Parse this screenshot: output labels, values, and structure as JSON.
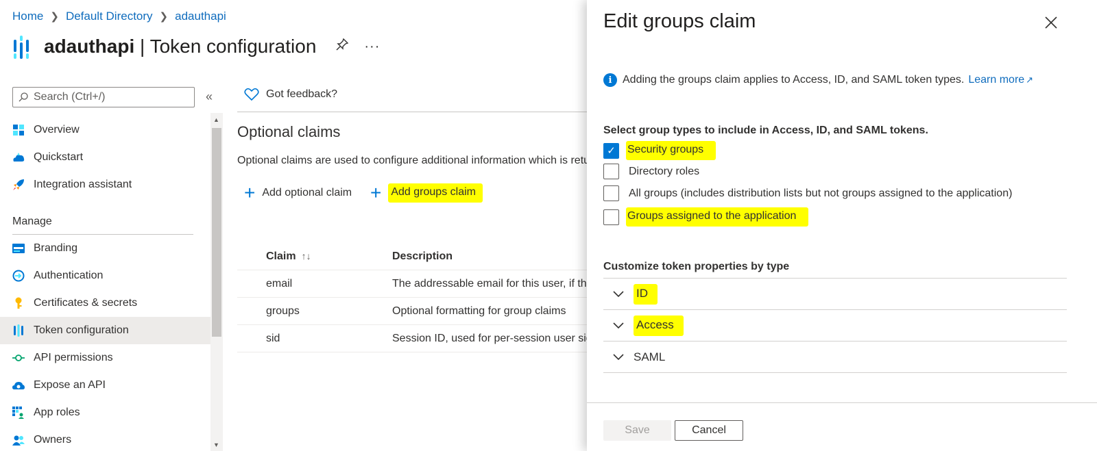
{
  "breadcrumb": [
    "Home",
    "Default Directory",
    "adauthapi"
  ],
  "header": {
    "app_name": "adauthapi",
    "separator": " | ",
    "page_name": "Token configuration",
    "more_label": "···"
  },
  "search": {
    "placeholder": "Search (Ctrl+/)"
  },
  "sidebar": {
    "top_items": [
      {
        "label": "Overview",
        "icon": "overview-icon"
      },
      {
        "label": "Quickstart",
        "icon": "quickstart-icon"
      },
      {
        "label": "Integration assistant",
        "icon": "rocket-icon"
      }
    ],
    "manage_label": "Manage",
    "manage_items": [
      {
        "label": "Branding",
        "icon": "branding-icon"
      },
      {
        "label": "Authentication",
        "icon": "authentication-icon"
      },
      {
        "label": "Certificates & secrets",
        "icon": "key-icon"
      },
      {
        "label": "Token configuration",
        "icon": "token-icon",
        "active": true
      },
      {
        "label": "API permissions",
        "icon": "api-permissions-icon"
      },
      {
        "label": "Expose an API",
        "icon": "cloud-icon"
      },
      {
        "label": "App roles",
        "icon": "app-roles-icon"
      },
      {
        "label": "Owners",
        "icon": "owners-icon"
      }
    ]
  },
  "main": {
    "feedback_label": "Got feedback?",
    "section_title": "Optional claims",
    "section_desc": "Optional claims are used to configure additional information which is returned in one or more tokens.",
    "add_optional_claim": "Add optional claim",
    "add_groups_claim": "Add groups claim",
    "table": {
      "headers": [
        "Claim",
        "Description"
      ],
      "sort_glyph": "↑↓",
      "rows": [
        {
          "claim": "email",
          "description": "The addressable email for this user, if the user has one"
        },
        {
          "claim": "groups",
          "description": "Optional formatting for group claims"
        },
        {
          "claim": "sid",
          "description": "Session ID, used for per-session user sign-out"
        }
      ]
    }
  },
  "panel": {
    "title": "Edit groups claim",
    "info_text": "Adding the groups claim applies to Access, ID, and SAML token types.",
    "learn_more": "Learn more",
    "group_types_label": "Select group types to include in Access, ID, and SAML tokens.",
    "group_types": [
      {
        "label": "Security groups",
        "checked": true,
        "highlighted": true
      },
      {
        "label": "Directory roles",
        "checked": false,
        "highlighted": false
      },
      {
        "label": "All groups (includes distribution lists but not groups assigned to the application)",
        "checked": false,
        "highlighted": false
      },
      {
        "label": "Groups assigned to the application",
        "checked": false,
        "highlighted": true
      }
    ],
    "customize_label": "Customize token properties by type",
    "token_types": [
      {
        "label": "ID",
        "highlighted": true
      },
      {
        "label": "Access",
        "highlighted": true
      },
      {
        "label": "SAML",
        "highlighted": false
      }
    ],
    "save_label": "Save",
    "cancel_label": "Cancel"
  },
  "colors": {
    "accent": "#0078d4",
    "link": "#0f6cbd",
    "highlight": "#ffff00"
  }
}
